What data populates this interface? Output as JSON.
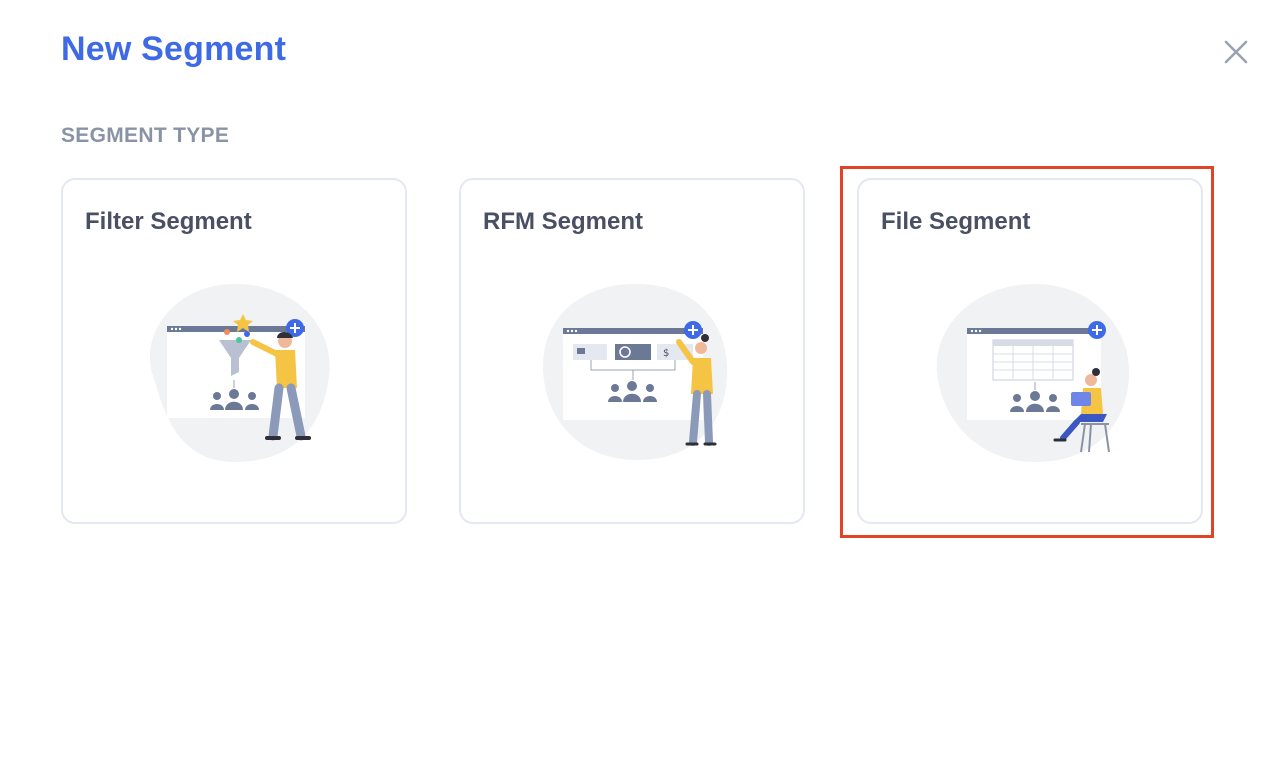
{
  "dialog": {
    "title": "New Segment",
    "close_icon": "close-icon"
  },
  "section": {
    "label": "SEGMENT TYPE"
  },
  "segment_types": [
    {
      "title": "Filter Segment",
      "illustration": "filter-segment-illustration",
      "selected": false
    },
    {
      "title": "RFM Segment",
      "illustration": "rfm-segment-illustration",
      "selected": false
    },
    {
      "title": "File Segment",
      "illustration": "file-segment-illustration",
      "selected": true
    }
  ],
  "colors": {
    "title": "#3f6ae6",
    "section_label": "#8a93a6",
    "card_border": "#e3e8f2",
    "card_title": "#4a5064",
    "selection_highlight": "#e04427",
    "accent_blue": "#3f6ae6",
    "figure_yellow": "#f6c445",
    "figure_pants": "#8a9ab8"
  }
}
